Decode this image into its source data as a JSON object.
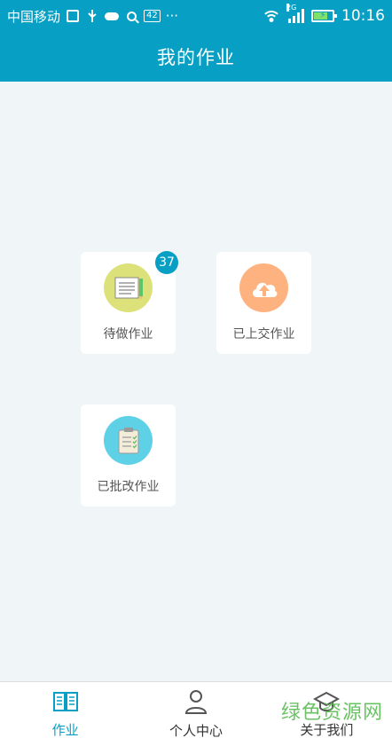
{
  "status_bar": {
    "carrier": "中国移动",
    "network_badge": "42",
    "more": "···",
    "signal_type": "2G",
    "time": "10:16",
    "icons": [
      "image-icon",
      "usb-icon",
      "cloud-icon",
      "search-icon",
      "wifi-icon",
      "signal-icon",
      "battery-charging-icon"
    ]
  },
  "header": {
    "title": "我的作业"
  },
  "cards": {
    "pending": {
      "label": "待做作业",
      "badge": "37",
      "icon": "notebook-icon",
      "color": "#dde179"
    },
    "submitted": {
      "label": "已上交作业",
      "icon": "cloud-upload-icon",
      "color": "#fdb27f"
    },
    "graded": {
      "label": "已批改作业",
      "icon": "clipboard-icon",
      "color": "#5fd1e6"
    }
  },
  "nav": {
    "homework": {
      "label": "作业",
      "icon": "book-icon"
    },
    "profile": {
      "label": "个人中心",
      "icon": "person-icon"
    },
    "about": {
      "label": "关于我们",
      "icon": "graduation-cap-icon"
    }
  },
  "watermark": "绿色资源网",
  "colors": {
    "primary": "#079fc4",
    "background": "#f0f5f8"
  }
}
